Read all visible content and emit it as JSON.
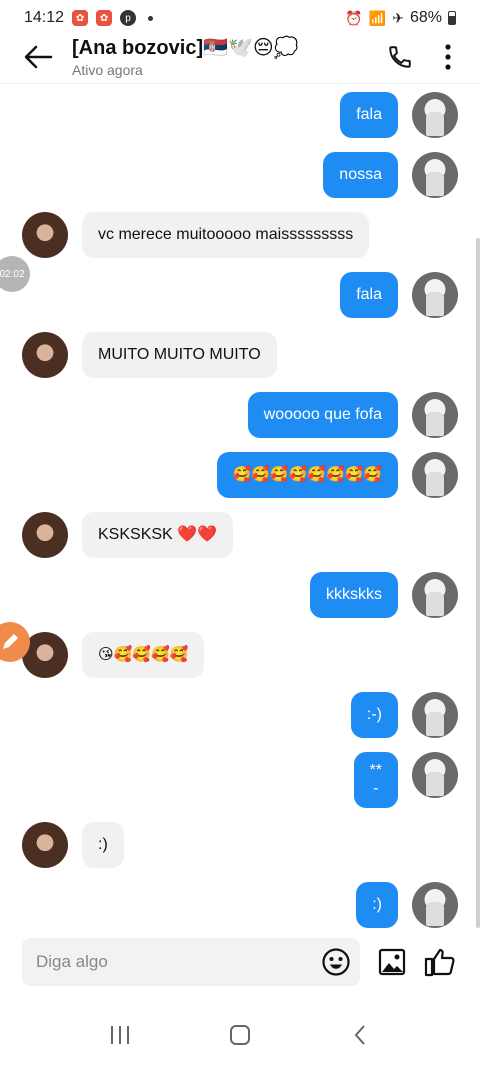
{
  "status_bar": {
    "time": "14:12",
    "battery": "68%"
  },
  "header": {
    "title": "[Ana bozovic]🇷🇸🕊️😔💭",
    "subtitle": "Ativo agora"
  },
  "messages": [
    {
      "sender": "me",
      "text": "fala"
    },
    {
      "sender": "me",
      "text": "nossa"
    },
    {
      "sender": "them",
      "text": "vc merece muitooooo maisssssssss"
    },
    {
      "sender": "me",
      "text": "fala"
    },
    {
      "sender": "them",
      "text": "MUITO MUITO MUITO"
    },
    {
      "sender": "me",
      "text": "wooooo que fofa"
    },
    {
      "sender": "me",
      "text": "🥰🥰🥰🥰🥰🥰🥰🥰"
    },
    {
      "sender": "them",
      "text": "KSKSKSK ❤️❤️"
    },
    {
      "sender": "me",
      "text": "kkkskks"
    },
    {
      "sender": "them",
      "text": "😘🥰🥰🥰🥰"
    },
    {
      "sender": "me",
      "text": ":-)"
    },
    {
      "sender": "me",
      "text": "**\n-"
    },
    {
      "sender": "them",
      "text": ":)"
    },
    {
      "sender": "me",
      "text": ":)"
    }
  ],
  "side_badge": "02:02",
  "composer": {
    "placeholder": "Diga algo"
  },
  "colors": {
    "my_bubble": "#1e8cf3",
    "their_bubble": "#f1f1f1"
  }
}
